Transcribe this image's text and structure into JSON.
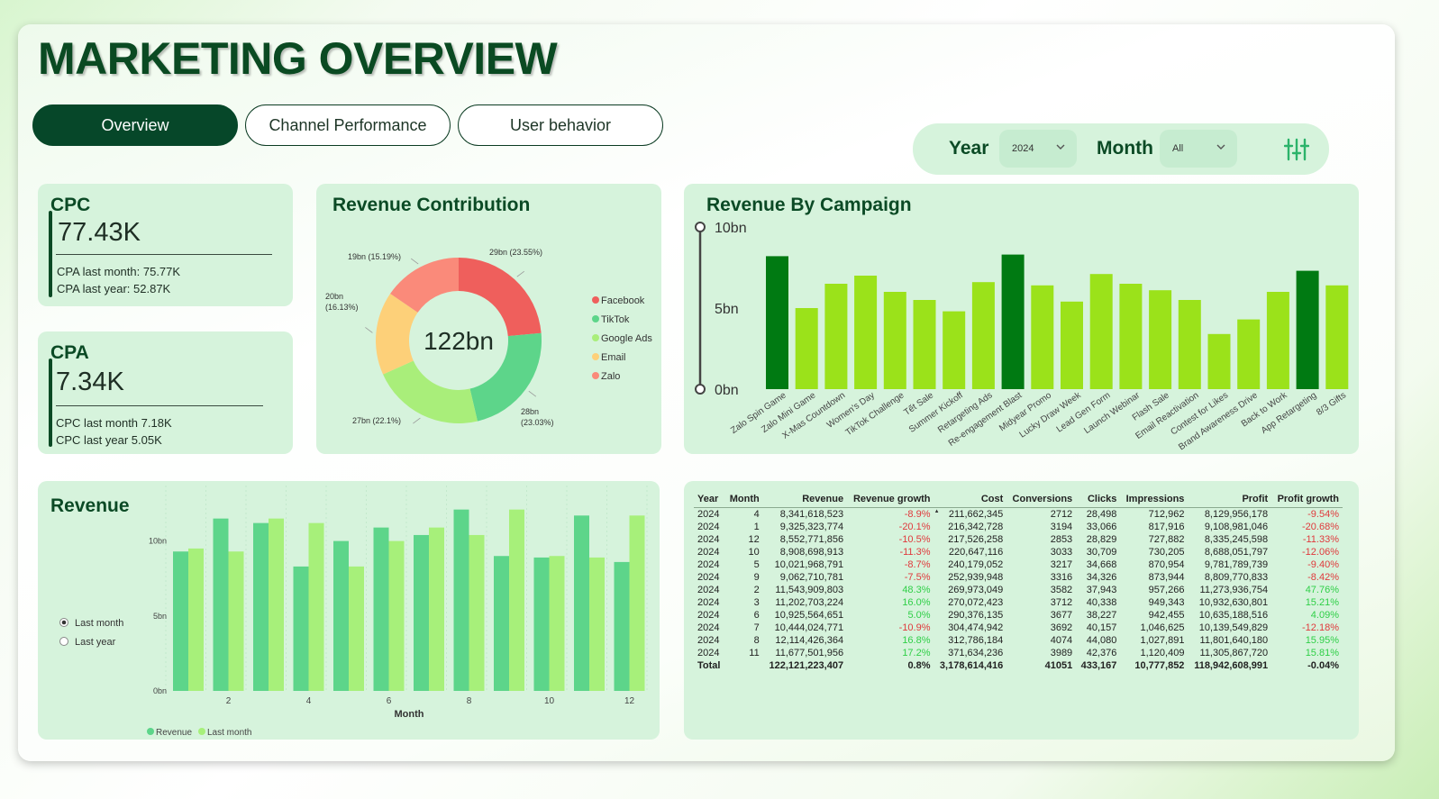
{
  "page": {
    "title": "MARKETING OVERVIEW"
  },
  "tabs": [
    "Overview",
    "Channel Performance",
    "User behavior"
  ],
  "filters": {
    "year_label": "Year",
    "year_value": "2024",
    "month_label": "Month",
    "month_value": "All",
    "filter_icon": "sliders-icon"
  },
  "kpi_cpc": {
    "title": "CPC",
    "value": "77.43K",
    "sub1": "CPA last month: 75.77K",
    "sub2": "CPA last year: 52.87K"
  },
  "kpi_cpa": {
    "title": "CPA",
    "value": "7.34K",
    "sub1": "CPC last month 7.18K",
    "sub2": "CPC last year 5.05K"
  },
  "colors": {
    "dark_green": "#0b4a25",
    "card_bg": "#d6f3dc",
    "campaign_bar": "#9be21a",
    "campaign_highlight": "#007a12",
    "revenue": "#5dd58a",
    "last_month": "#a7f07a",
    "negative": "#e0393c",
    "positive": "#2fcf47"
  },
  "donut": {
    "title": "Revenue Contribution",
    "center_label": "122bn",
    "chart_data": {
      "type": "pie",
      "slices": [
        {
          "name": "Facebook",
          "value": 29,
          "label": "29bn (23.55%)",
          "color": "#ef5f5c"
        },
        {
          "name": "TikTok",
          "value": 28,
          "label": "28bn (23.03%)",
          "color": "#5dd58a"
        },
        {
          "name": "Google Ads",
          "value": 27,
          "label": "27bn (22.1%)",
          "color": "#a9ee7a"
        },
        {
          "name": "Email",
          "value": 20,
          "label": "20bn (16.13%)",
          "color": "#fdd079"
        },
        {
          "name": "Zalo",
          "value": 19,
          "label": "19bn (15.19%)",
          "color": "#fa8a7a"
        }
      ]
    }
  },
  "campaign_chart": {
    "title": "Revenue By Campaign",
    "chart_data": {
      "type": "bar",
      "categories": [
        "Zalo Spin Game",
        "Zalo Mini Game",
        "X-Mas Countdown",
        "Women's Day",
        "TikTok Challenge",
        "Tết Sale",
        "Summer Kickoff",
        "Retargeting Ads",
        "Re-engagement Blast",
        "Midyear Promo",
        "Lucky Draw Week",
        "Lead Gen Form",
        "Launch Webinar",
        "Flash Sale",
        "Email Reactivation",
        "Contest for Likes",
        "Brand Awareness Drive",
        "Back to Work",
        "App Retargeting",
        "8/3 Gifts"
      ],
      "values": [
        8.2,
        5.0,
        6.5,
        7.0,
        6.0,
        5.5,
        4.8,
        6.6,
        8.3,
        6.4,
        5.4,
        7.1,
        6.5,
        6.1,
        5.5,
        3.4,
        4.3,
        6.0,
        7.3,
        6.4
      ],
      "highlighted": [
        0,
        8,
        18
      ],
      "ylim": [
        0,
        10
      ],
      "yticks": [
        "0bn",
        "5bn",
        "10bn"
      ]
    }
  },
  "revenue_chart": {
    "title": "Revenue",
    "radio_options": [
      "Last month",
      "Last year"
    ],
    "selected_option": 0,
    "chart_data": {
      "type": "bar",
      "xlabel": "Month",
      "categories": [
        "1",
        "2",
        "3",
        "4",
        "5",
        "6",
        "7",
        "8",
        "9",
        "10",
        "11",
        "12"
      ],
      "xticks": [
        "2",
        "4",
        "6",
        "8",
        "10",
        "12"
      ],
      "yticks": [
        "0bn",
        "5bn",
        "10bn"
      ],
      "ylim": [
        0,
        12.5
      ],
      "series": [
        {
          "name": "Revenue",
          "values": [
            9.3,
            11.5,
            11.2,
            8.3,
            10.0,
            10.9,
            10.4,
            12.1,
            9.0,
            8.9,
            11.7,
            8.6
          ]
        },
        {
          "name": "Last month",
          "values": [
            9.5,
            9.3,
            11.5,
            11.2,
            8.3,
            10.0,
            10.9,
            10.4,
            12.1,
            9.0,
            8.9,
            11.7
          ]
        }
      ]
    }
  },
  "table": {
    "sort_column": "Revenue growth",
    "headers": [
      "Year",
      "Month",
      "Revenue",
      "Revenue growth",
      "Cost",
      "Conversions",
      "Clicks",
      "Impressions",
      "Profit",
      "Profit growth"
    ],
    "rows": [
      [
        "2024",
        "4",
        "8,341,618,523",
        "-8.9%",
        "211,662,345",
        "2712",
        "28,498",
        "712,962",
        "8,129,956,178",
        "-9.54%"
      ],
      [
        "2024",
        "1",
        "9,325,323,774",
        "-20.1%",
        "216,342,728",
        "3194",
        "33,066",
        "817,916",
        "9,108,981,046",
        "-20.68%"
      ],
      [
        "2024",
        "12",
        "8,552,771,856",
        "-10.5%",
        "217,526,258",
        "2853",
        "28,829",
        "727,882",
        "8,335,245,598",
        "-11.33%"
      ],
      [
        "2024",
        "10",
        "8,908,698,913",
        "-11.3%",
        "220,647,116",
        "3033",
        "30,709",
        "730,205",
        "8,688,051,797",
        "-12.06%"
      ],
      [
        "2024",
        "5",
        "10,021,968,791",
        "-8.7%",
        "240,179,052",
        "3217",
        "34,668",
        "870,954",
        "9,781,789,739",
        "-9.40%"
      ],
      [
        "2024",
        "9",
        "9,062,710,781",
        "-7.5%",
        "252,939,948",
        "3316",
        "34,326",
        "873,944",
        "8,809,770,833",
        "-8.42%"
      ],
      [
        "2024",
        "2",
        "11,543,909,803",
        "48.3%",
        "269,973,049",
        "3582",
        "37,943",
        "957,266",
        "11,273,936,754",
        "47.76%"
      ],
      [
        "2024",
        "3",
        "11,202,703,224",
        "16.0%",
        "270,072,423",
        "3712",
        "40,338",
        "949,343",
        "10,932,630,801",
        "15.21%"
      ],
      [
        "2024",
        "6",
        "10,925,564,651",
        "5.0%",
        "290,376,135",
        "3677",
        "38,227",
        "942,455",
        "10,635,188,516",
        "4.09%"
      ],
      [
        "2024",
        "7",
        "10,444,024,771",
        "-10.9%",
        "304,474,942",
        "3692",
        "40,157",
        "1,046,625",
        "10,139,549,829",
        "-12.18%"
      ],
      [
        "2024",
        "8",
        "12,114,426,364",
        "16.8%",
        "312,786,184",
        "4074",
        "44,080",
        "1,027,891",
        "11,801,640,180",
        "15.95%"
      ],
      [
        "2024",
        "11",
        "11,677,501,956",
        "17.2%",
        "371,634,236",
        "3989",
        "42,376",
        "1,120,409",
        "11,305,867,720",
        "15.81%"
      ]
    ],
    "total": [
      "Total",
      "",
      "122,121,223,407",
      "0.8%",
      "3,178,614,416",
      "41051",
      "433,167",
      "10,777,852",
      "118,942,608,991",
      "-0.04%"
    ]
  }
}
